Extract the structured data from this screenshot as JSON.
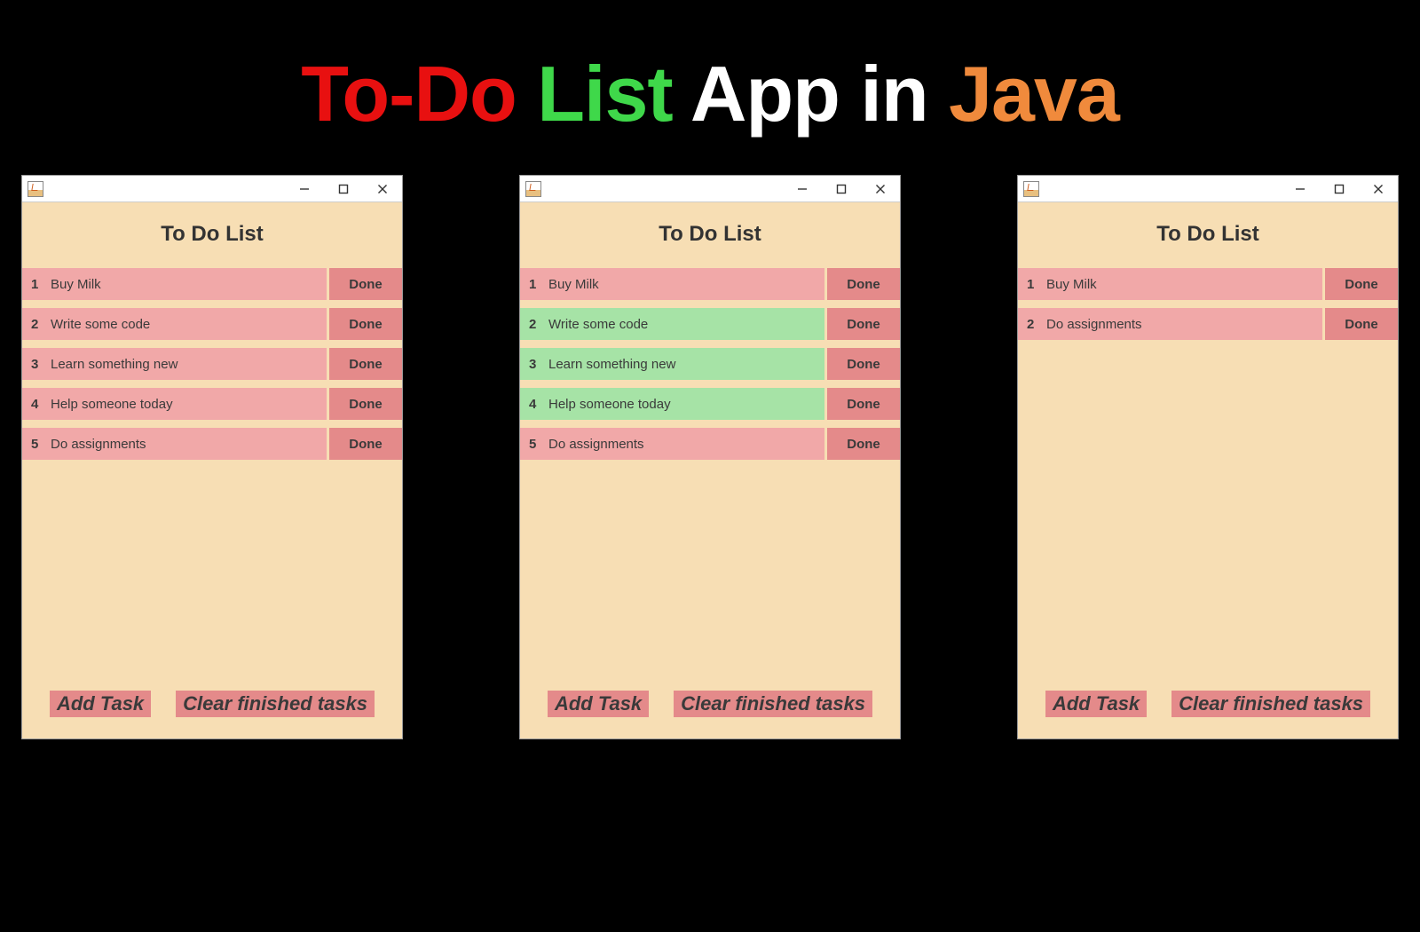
{
  "banner": {
    "parts": [
      {
        "text": "To-Do",
        "color": "#e81010"
      },
      {
        "text": " ",
        "color": "#000"
      },
      {
        "text": "List",
        "color": "#3fd84a"
      },
      {
        "text": " App in ",
        "color": "#ffffff"
      },
      {
        "text": "Java",
        "color": "#f08a3c"
      }
    ]
  },
  "common": {
    "app_title": "To Do List",
    "done_label": "Done",
    "add_task_label": "Add Task",
    "clear_label": "Clear finished tasks"
  },
  "windows": [
    {
      "tasks": [
        {
          "num": "1",
          "text": "Buy Milk",
          "state": "pink"
        },
        {
          "num": "2",
          "text": "Write some code",
          "state": "pink"
        },
        {
          "num": "3",
          "text": "Learn something new",
          "state": "pink"
        },
        {
          "num": "4",
          "text": "Help someone today",
          "state": "pink"
        },
        {
          "num": "5",
          "text": "Do assignments",
          "state": "pink"
        }
      ]
    },
    {
      "tasks": [
        {
          "num": "1",
          "text": "Buy Milk",
          "state": "pink"
        },
        {
          "num": "2",
          "text": "Write some code",
          "state": "green"
        },
        {
          "num": "3",
          "text": "Learn something new",
          "state": "green"
        },
        {
          "num": "4",
          "text": "Help someone today",
          "state": "green"
        },
        {
          "num": "5",
          "text": "Do assignments",
          "state": "pink"
        }
      ]
    },
    {
      "tasks": [
        {
          "num": "1",
          "text": "Buy Milk",
          "state": "pink"
        },
        {
          "num": "2",
          "text": "Do assignments",
          "state": "pink"
        }
      ]
    }
  ]
}
